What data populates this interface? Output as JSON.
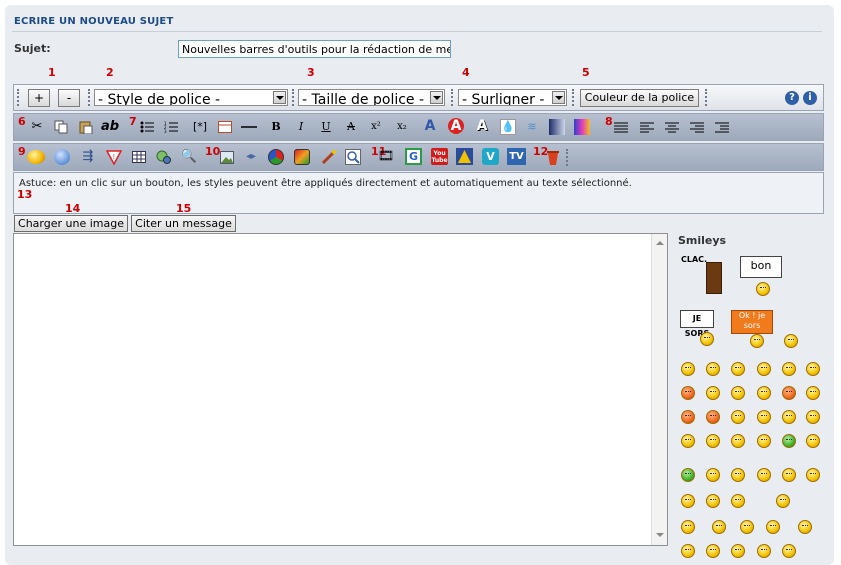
{
  "page_title": "ECRIRE UN NOUVEAU SUJET",
  "subject": {
    "label": "Sujet:",
    "value": "Nouvelles barres d'outils pour la rédaction de me"
  },
  "numbers": {
    "n1": "1",
    "n2": "2",
    "n3": "3",
    "n4": "4",
    "n5": "5",
    "n6": "6",
    "n7": "7",
    "n8": "8",
    "n9": "9",
    "n10": "10",
    "n11": "11",
    "n12": "12",
    "n13": "13",
    "n14": "14",
    "n15": "15"
  },
  "toolbar1": {
    "plus_label": "+",
    "minus_label": "-",
    "font_style": "- Style de police -",
    "font_size": "- Taille de police -",
    "highlight": "- Surligner -",
    "font_color_label": "Couleur de la police",
    "help_icon_label": "?",
    "info_icon_label": "i"
  },
  "toolbar2": {
    "icons": [
      "scissors-icon",
      "copy-icon",
      "paste-icon",
      "spellcheck-icon",
      "bullet-list-icon",
      "numbered-list-icon",
      "list-item-icon",
      "table-icon",
      "horizontal-rule-icon",
      "bold-icon",
      "italic-icon",
      "underline-icon",
      "strikethrough-icon",
      "superscript-icon",
      "subscript-icon",
      "font-size-icon",
      "font-color-red-icon",
      "font-shadow-icon",
      "blur-icon",
      "wave-icon",
      "gradient-gray-icon",
      "gradient-color-icon",
      "align-justify-icon",
      "align-left-icon",
      "align-center-icon",
      "align-right-icon",
      "indent-icon"
    ],
    "spellcheck_text": "ab",
    "list_item_text": "[*]",
    "bold_text": "B",
    "italic_text": "I",
    "underline_text": "U",
    "strike_text": "A",
    "sup_text": "x²",
    "sub_text": "x₂"
  },
  "toolbar3": {
    "icons": [
      "smiley-insert-icon",
      "globe-link-icon",
      "quote-icon",
      "spoiler-icon",
      "table-grid-icon",
      "hide-icon",
      "search-icon",
      "image-icon",
      "code-icon",
      "flash-icon",
      "anime-icon",
      "wand-icon",
      "color-picker-icon",
      "film-icon",
      "google-icon",
      "youtube-icon",
      "dailymotion-icon",
      "vimeo-icon",
      "tv-icon",
      "trash-icon"
    ],
    "google_text": "G",
    "youtube_text": "You Tube",
    "vimeo_text": "V",
    "tv_text": "TV"
  },
  "hint_text": "Astuce: en un clic sur un bouton, les styles peuvent être appliqués directement et automatiquement au texte sélectionné.",
  "upload_button": "Charger une image",
  "quote_button": "Citer un message",
  "smileys": {
    "title": "Smileys",
    "clac_text": "CLAC.",
    "bon_text": "bon",
    "jesors_text": "JE SORS",
    "oksors_text": "Ok ! je sors"
  },
  "colors": {
    "title": "#1d4b87",
    "numbers": "#d10000",
    "panel": "#e9edf2",
    "toolbar": "#a9b4c6"
  }
}
